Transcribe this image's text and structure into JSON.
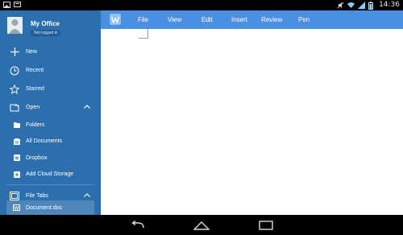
{
  "status_bar": {
    "time": "14:36"
  },
  "sidebar": {
    "profile": {
      "name": "My Office",
      "status": "Not logged in"
    },
    "items": [
      {
        "label": "New",
        "icon": "plus-icon"
      },
      {
        "label": "Recent",
        "icon": "clock-icon"
      },
      {
        "label": "Starred",
        "icon": "star-icon"
      },
      {
        "label": "Open",
        "icon": "folder-open-icon"
      }
    ],
    "open_sub": [
      {
        "label": "Folders",
        "icon": "folder-icon"
      },
      {
        "label": "All Documents",
        "icon": "documents-icon"
      },
      {
        "label": "Dropbox",
        "icon": "dropbox-icon"
      },
      {
        "label": "Add Cloud Storage",
        "icon": "add-cloud-icon"
      }
    ],
    "file_tabs": {
      "label": "File Tabs",
      "icon": "file-tabs-icon"
    },
    "open_document": {
      "label": "Document.doc",
      "icon": "word-document-icon"
    }
  },
  "toolbar": {
    "tabs": [
      "File",
      "View",
      "Edit",
      "Insert",
      "Review",
      "Pen"
    ],
    "accent_color": "#4a90e2"
  },
  "colors": {
    "sidebar": "#2c6fae",
    "selected_tab": "#4f87bd"
  }
}
